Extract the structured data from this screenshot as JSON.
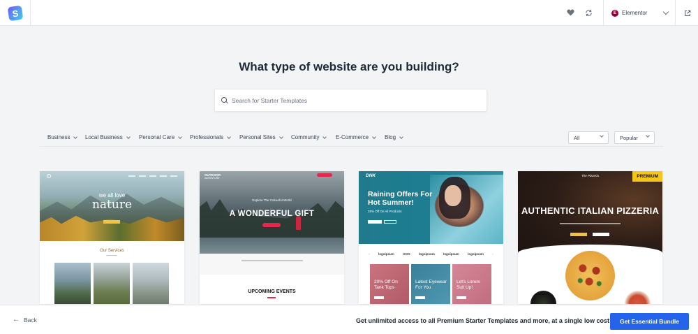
{
  "topbar": {
    "logo_letter": "S",
    "favorites_icon": "heart-icon",
    "sync_icon": "refresh-icon",
    "builder": {
      "badge": "E",
      "label": "Elementor"
    },
    "exit_icon": "external-link-icon"
  },
  "main": {
    "title": "What type of website are you building?",
    "search_placeholder": "Search for Starter Templates",
    "categories": [
      {
        "label": "Business"
      },
      {
        "label": "Local Business"
      },
      {
        "label": "Personal Care"
      },
      {
        "label": "Professionals"
      },
      {
        "label": "Personal Sites"
      },
      {
        "label": "Community"
      },
      {
        "label": "E-Commerce"
      },
      {
        "label": "Blog"
      }
    ],
    "type_filter": {
      "selected": "All"
    },
    "sort_filter": {
      "selected": "Popular"
    }
  },
  "cards": [
    {
      "hero_small": "we all love",
      "hero_big": "nature",
      "section_title": "Our Services"
    },
    {
      "brand_line1": "OUTDOOR",
      "brand_line2": "ADVENTURE",
      "hero_small": "Explore The Colourful World",
      "hero_big": "A WONDERFUL GIFT",
      "section_title": "UPCOMING EVENTS"
    },
    {
      "brand": "DNK",
      "hero_line1": "Raining Offers For",
      "hero_line2": "Hot Summer!",
      "hero_sub": "25% Off On All Products",
      "logos": [
        "logoipsum",
        "OOO",
        "logoipsum",
        "logoipsum",
        "logoipsum"
      ],
      "tiles": [
        {
          "line1": "20% Off On",
          "line2": "Tank Tops"
        },
        {
          "line1": "Latest Eyewear",
          "line2": "For You"
        },
        {
          "line1": "Let's Lorem",
          "line2": "Suit Up!"
        }
      ]
    },
    {
      "badge": "PREMIUM",
      "brand": "The Pizzeria",
      "hero_title": "AUTHENTIC ITALIAN PIZZERIA"
    }
  ],
  "bottombar": {
    "back_label": "Back",
    "promo": "Get unlimited access to all Premium Starter Templates and more, at a single low cost!",
    "cta_label": "Get Essential Bundle"
  },
  "colors": {
    "accent": "#2563eb",
    "premium_badge": "#f5c518",
    "elementor": "#92003b"
  }
}
